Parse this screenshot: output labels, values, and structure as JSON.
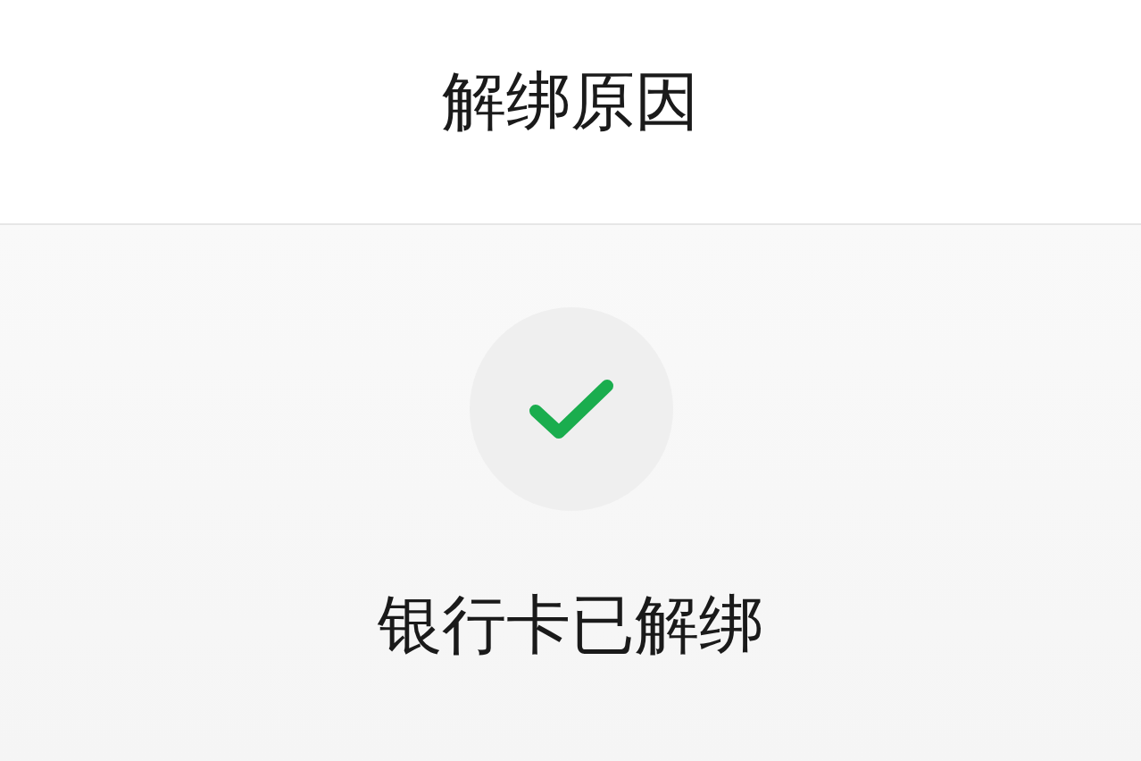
{
  "header": {
    "title": "解绑原因"
  },
  "result": {
    "message": "银行卡已解绑"
  }
}
